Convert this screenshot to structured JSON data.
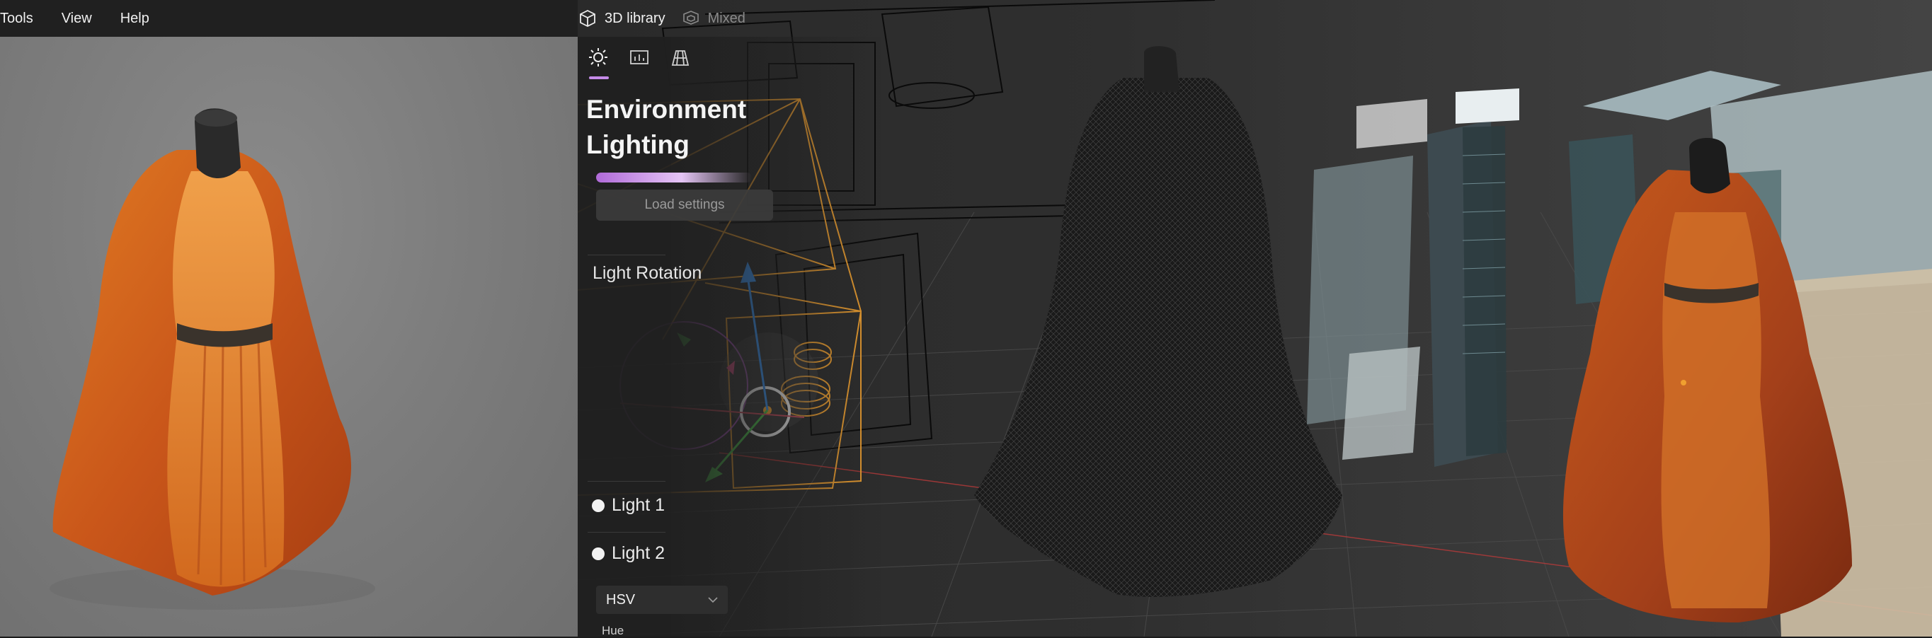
{
  "menu": {
    "items": [
      "Tools",
      "View",
      "Help"
    ]
  },
  "right_toolbar": {
    "library_label": "3D library",
    "mixed_label": "Mixed"
  },
  "panel": {
    "title_line1": "Environment",
    "title_line2": "Lighting",
    "load_button": "Load settings",
    "light_rotation_label": "Light Rotation",
    "light1": "Light 1",
    "light2": "Light 2",
    "color_mode": "HSV",
    "hue_label": "Hue"
  },
  "colors": {
    "accent": "#c58be8",
    "gizmo_orange": "#f0a030",
    "axis_blue": "#3a8ee8",
    "axis_green": "#4bbf4b"
  }
}
